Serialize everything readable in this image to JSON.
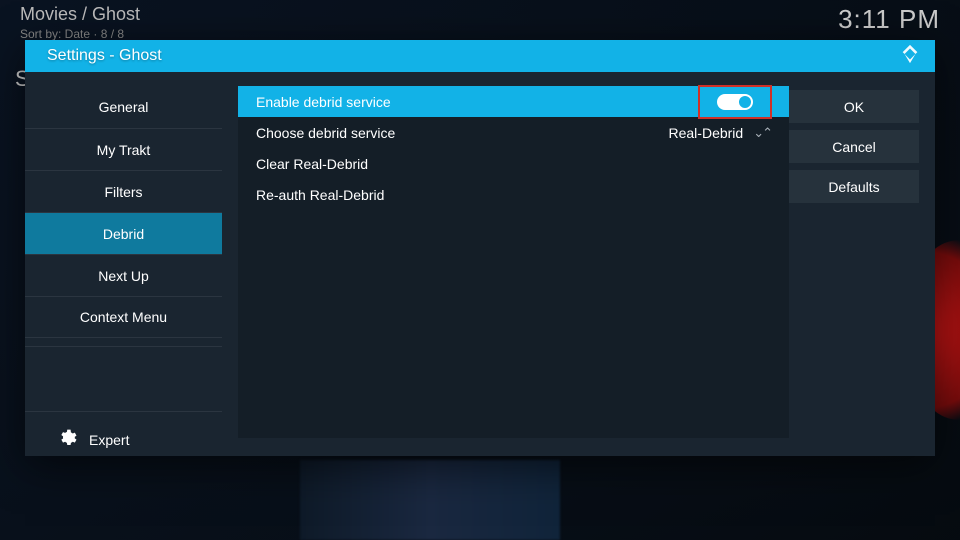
{
  "breadcrumb": "Movies / Ghost",
  "sort_line": "Sort by: Date  ·  8 / 8",
  "clock": "3:11 PM",
  "bg_letter": "S",
  "dialog": {
    "title": "Settings - Ghost",
    "categories": [
      {
        "label": "General",
        "selected": false
      },
      {
        "label": "My Trakt",
        "selected": false
      },
      {
        "label": "Filters",
        "selected": false
      },
      {
        "label": "Debrid",
        "selected": true
      },
      {
        "label": "Next Up",
        "selected": false
      },
      {
        "label": "Context Menu",
        "selected": false
      }
    ],
    "level": {
      "label": "Expert"
    },
    "settings": [
      {
        "key": "enable",
        "label": "Enable debrid service",
        "type": "toggle",
        "on": true,
        "highlighted": true
      },
      {
        "key": "choose",
        "label": "Choose debrid service",
        "type": "select",
        "value": "Real-Debrid"
      },
      {
        "key": "clear",
        "label": "Clear Real-Debrid",
        "type": "action"
      },
      {
        "key": "reauth",
        "label": "Re-auth Real-Debrid",
        "type": "action"
      }
    ],
    "buttons": {
      "ok": "OK",
      "cancel": "Cancel",
      "defaults": "Defaults"
    }
  }
}
